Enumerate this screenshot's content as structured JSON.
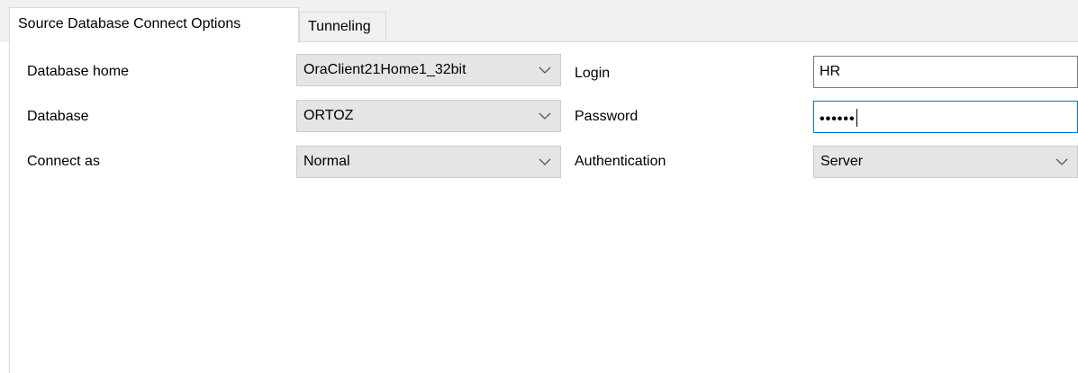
{
  "tabs": [
    {
      "label": "Source Database Connect Options",
      "active": true
    },
    {
      "label": "Tunneling",
      "active": false
    }
  ],
  "fields": {
    "database_home": {
      "label": "Database home",
      "value": "OraClient21Home1_32bit"
    },
    "database": {
      "label": "Database",
      "value": "ORTOZ"
    },
    "connect_as": {
      "label": "Connect as",
      "value": "Normal"
    },
    "login": {
      "label": "Login",
      "value": "HR"
    },
    "password": {
      "label": "Password",
      "value": "••••••"
    },
    "authentication": {
      "label": "Authentication",
      "value": "Server"
    }
  },
  "icons": {
    "dropdown": "chevron-down-icon"
  },
  "colors": {
    "focus_border": "#0078d7",
    "combo_background": "#e5e5e5"
  }
}
